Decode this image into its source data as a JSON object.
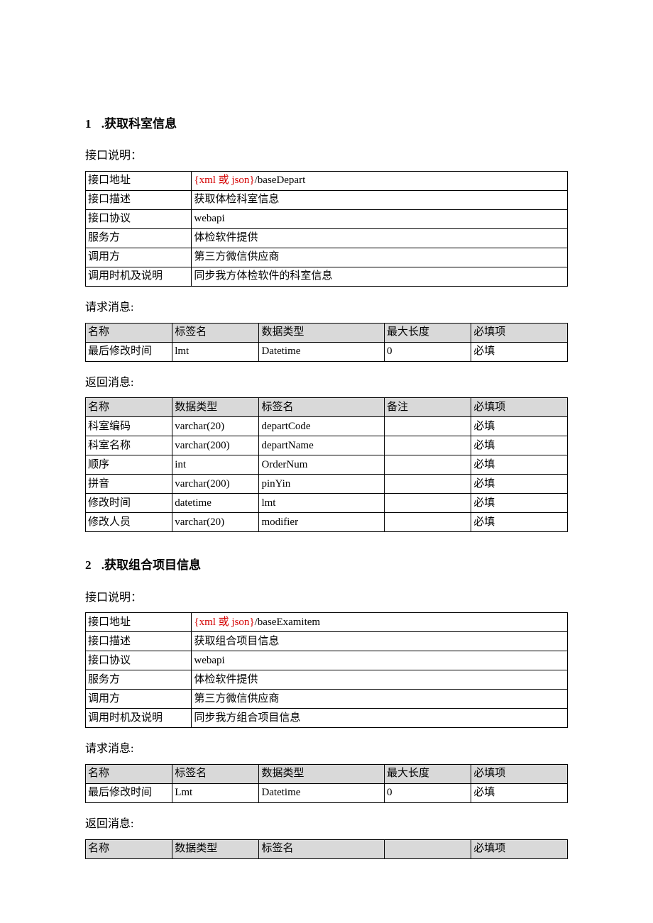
{
  "sections": [
    {
      "num": "1",
      "title": ".获取科室信息",
      "info_heading": "接口说明：",
      "info": [
        {
          "label": "接口地址",
          "value_red": "{xml 或 json}",
          "value": "/baseDepart"
        },
        {
          "label": "接口描述",
          "value": "获取体检科室信息"
        },
        {
          "label": "接口协议",
          "value": "webapi"
        },
        {
          "label": "服务方",
          "value": "体检软件提供"
        },
        {
          "label": "调用方",
          "value": "第三方微信供应商"
        },
        {
          "label": "调用时机及说明",
          "value": "同步我方体检软件的科室信息"
        }
      ],
      "request_heading": "请求消息:",
      "request_headers": [
        "名称",
        "标签名",
        "数据类型",
        "最大长度",
        "必填项"
      ],
      "request_rows": [
        [
          "最后修改时间",
          "lmt",
          "Datetime",
          "0",
          "必填"
        ]
      ],
      "response_heading": "返回消息:",
      "response_headers": [
        "名称",
        "数据类型",
        "标签名",
        "备注",
        "必填项"
      ],
      "response_rows": [
        [
          "科室编码",
          "varchar(20)",
          "departCode",
          "",
          "必填"
        ],
        [
          "科室名称",
          "varchar(200)",
          "departName",
          "",
          "必填"
        ],
        [
          "顺序",
          "int",
          "OrderNum",
          "",
          "必填"
        ],
        [
          "拼音",
          "varchar(200)",
          "pinYin",
          "",
          "必填"
        ],
        [
          "修改时间",
          "datetime",
          "lmt",
          "",
          "必填"
        ],
        [
          "修改人员",
          "varchar(20)",
          "modifier",
          "",
          "必填"
        ]
      ]
    },
    {
      "num": "2",
      "title": ".获取组合项目信息",
      "info_heading": "接口说明：",
      "info": [
        {
          "label": "接口地址",
          "value_red": "{xml 或 json}",
          "value": "/baseExamitem"
        },
        {
          "label": "接口描述",
          "value": "获取组合项目信息"
        },
        {
          "label": "接口协议",
          "value": "webapi"
        },
        {
          "label": "服务方",
          "value": "体检软件提供"
        },
        {
          "label": "调用方",
          "value": "第三方微信供应商"
        },
        {
          "label": "调用时机及说明",
          "value": "同步我方组合项目信息"
        }
      ],
      "request_heading": "请求消息:",
      "request_headers": [
        "名称",
        "标签名",
        "数据类型",
        "最大长度",
        "必填项"
      ],
      "request_rows": [
        [
          "最后修改时间",
          "Lmt",
          "Datetime",
          "0",
          "必填"
        ]
      ],
      "response_heading": "返回消息:",
      "response_headers": [
        "名称",
        "数据类型",
        "标签名",
        "",
        "必填项"
      ],
      "response_rows": []
    }
  ]
}
